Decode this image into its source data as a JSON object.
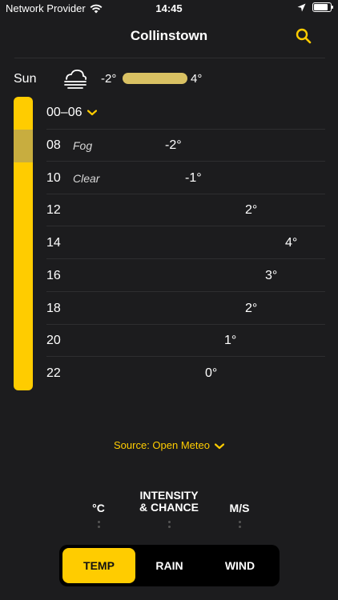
{
  "status_bar": {
    "carrier": "Network Provider",
    "time": "14:45"
  },
  "nav": {
    "title": "Collinstown"
  },
  "day": {
    "label": "Sun",
    "temp_min": "-2°",
    "temp_max": "4°",
    "icon": "fog-cloud-icon"
  },
  "period": {
    "label": "00–06"
  },
  "hours": [
    {
      "hour": "08",
      "condition": "Fog",
      "temp": "-2°"
    },
    {
      "hour": "10",
      "condition": "Clear",
      "temp": "-1°"
    },
    {
      "hour": "12",
      "condition": "",
      "temp": "2°"
    },
    {
      "hour": "14",
      "condition": "",
      "temp": "4°"
    },
    {
      "hour": "16",
      "condition": "",
      "temp": "3°"
    },
    {
      "hour": "18",
      "condition": "",
      "temp": "2°"
    },
    {
      "hour": "20",
      "condition": "",
      "temp": "1°"
    },
    {
      "hour": "22",
      "condition": "",
      "temp": "0°"
    }
  ],
  "source": {
    "label": "Source: Open Meteo"
  },
  "units": {
    "temp": "°C",
    "rain_line1": "INTENSITY",
    "rain_line2": "& CHANCE",
    "wind": "M/S"
  },
  "tabs": {
    "temp": "TEMP",
    "rain": "RAIN",
    "wind": "WIND",
    "active": "temp"
  },
  "colors": {
    "accent": "#ffcc00",
    "background": "#1c1c1e"
  }
}
